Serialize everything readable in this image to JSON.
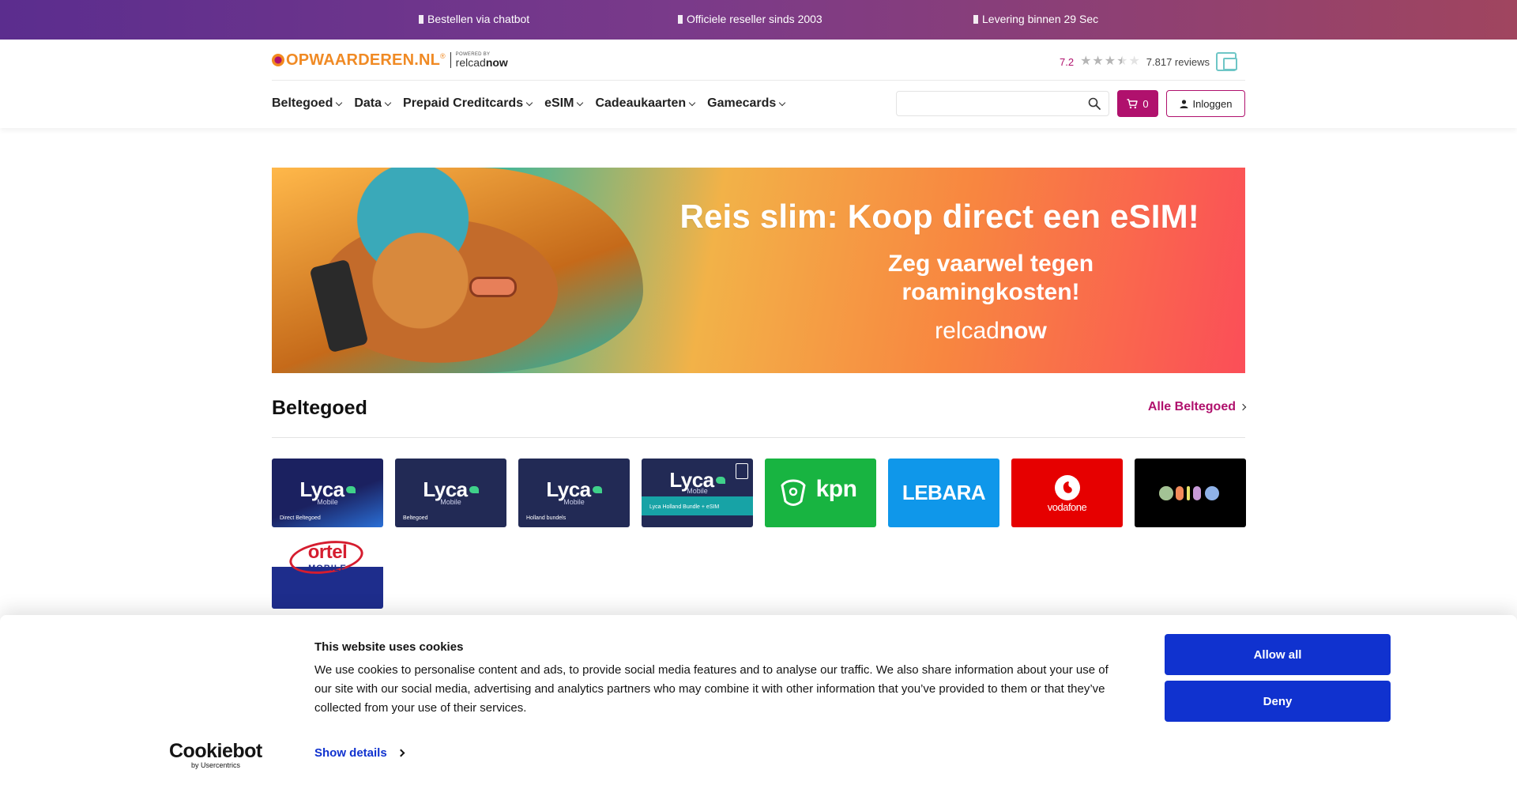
{
  "topbar": {
    "usps": [
      "Bestellen via chatbot",
      "Officiele reseller sinds 2003",
      "Levering binnen 29 Sec"
    ]
  },
  "logo": {
    "name": "OPWAARDEREN.NL",
    "tm": "®",
    "powered_by": "POWERED BY",
    "partner_light": "relcad",
    "partner_bold": "now"
  },
  "rating": {
    "score": "7.2",
    "stars": 3.5,
    "reviews": "7.817 reviews"
  },
  "nav": {
    "items": [
      "Beltegoed",
      "Data",
      "Prepaid Creditcards",
      "eSIM",
      "Cadeaukaarten",
      "Gamecards"
    ]
  },
  "search": {
    "placeholder": ""
  },
  "cart": {
    "count": "0"
  },
  "login": {
    "label": "Inloggen"
  },
  "banner": {
    "headline": "Reis slim: Koop direct een eSIM!",
    "sub_line1": "Zeg vaarwel tegen",
    "sub_line2": "roamingkosten!",
    "brand_light": "relcad",
    "brand_bold": "now"
  },
  "section": {
    "title": "Beltegoed",
    "all_link": "Alle Beltegoed"
  },
  "tiles": [
    {
      "brand": "Lyca",
      "sub": "Mobile",
      "caption": "Direct Beltegoed",
      "bg": "#1c2a6b"
    },
    {
      "brand": "Lyca",
      "sub": "Mobile",
      "caption": "Beltegoed",
      "bg": "#222a55"
    },
    {
      "brand": "Lyca",
      "sub": "Mobile",
      "caption": "Holland bundels",
      "bg": "#222a55"
    },
    {
      "brand": "Lyca",
      "sub": "Mobile",
      "caption": "Lyca Holland Bundle + eSIM",
      "bg": "#222a55"
    },
    {
      "brand": "kpn",
      "bg": "#18b441"
    },
    {
      "brand": "LEBARA",
      "bg": "#0f97ea"
    },
    {
      "brand": "vodafone",
      "bg": "#e60000"
    },
    {
      "brand": "odido",
      "bg": "#000000"
    },
    {
      "brand": "ortel",
      "sub": "MOBILE",
      "bg": "#1e2d8c"
    }
  ],
  "colors": {
    "accent": "#b0116d",
    "cookie_button": "#1032cf",
    "logo_orange": "#f08a24"
  },
  "cookie": {
    "title": "This website uses cookies",
    "body": "We use cookies to personalise content and ads, to provide social media features and to analyse our traffic. We also share information about your use of our site with our social media, advertising and analytics partners who may combine it with other information that you’ve provided to them or that they’ve collected from your use of their services.",
    "show_details": "Show details",
    "allow_all": "Allow all",
    "deny": "Deny",
    "provider": "Cookiebot",
    "provider_by": "by Usercentrics"
  }
}
